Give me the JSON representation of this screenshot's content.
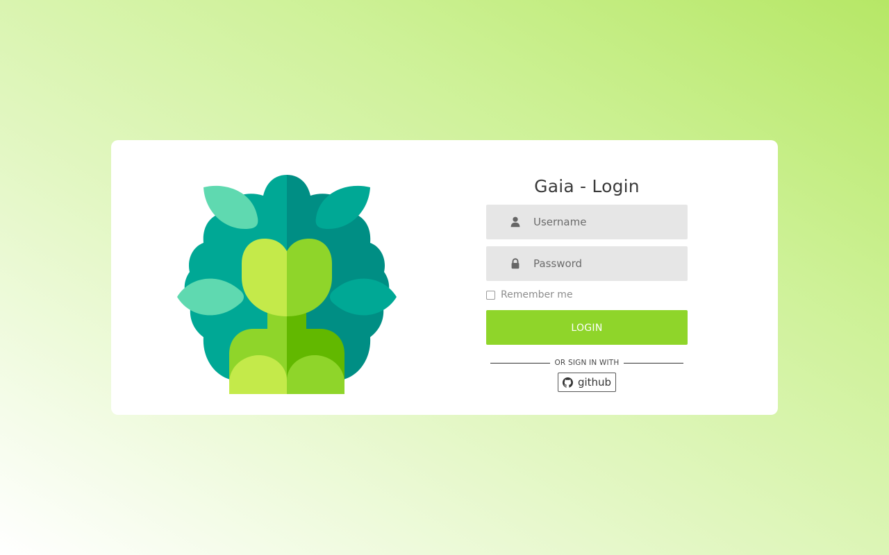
{
  "login": {
    "title": "Gaia - Login",
    "username_placeholder": "Username",
    "password_placeholder": "Password",
    "remember_label": "Remember me",
    "login_button": "LOGIN",
    "divider_text": "OR SIGN IN WITH",
    "oauth_provider": "github"
  },
  "icons": {
    "username": "user-icon",
    "password": "lock-icon",
    "oauth": "github-icon"
  },
  "colors": {
    "accent": "#8fd52a",
    "card": "#ffffff",
    "field": "#e6e6e6"
  }
}
